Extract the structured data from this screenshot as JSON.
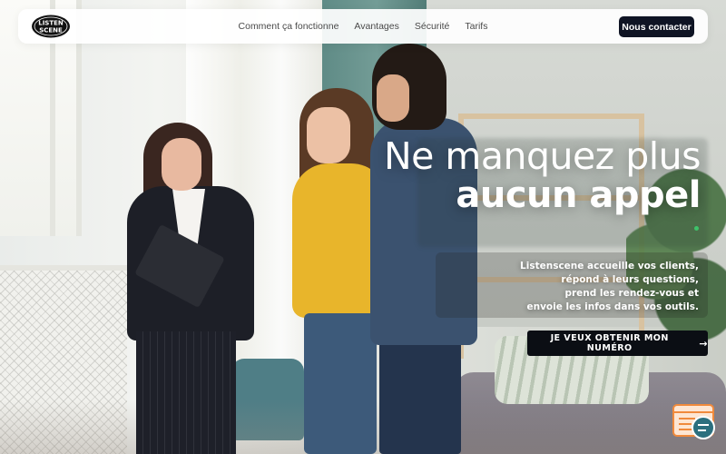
{
  "brand": {
    "logo_text_line1": "LISTEN",
    "logo_text_line2": "SCENE"
  },
  "nav": {
    "links": [
      {
        "label": "Comment ça fonctionne"
      },
      {
        "label": "Avantages"
      },
      {
        "label": "Sécurité"
      },
      {
        "label": "Tarifs"
      }
    ],
    "contact_label": "Nous contacter"
  },
  "hero": {
    "title_line1": "Ne manquez plus",
    "title_line2": "aucun appel",
    "description_lines": [
      "Listenscene accueille vos clients,",
      "répond à leurs questions,",
      "prend les rendez-vous et",
      "envoie les infos dans vos outils."
    ],
    "cta_label": "JE VEUX OBTENIR MON NUMÉRO",
    "cta_icon": "arrow-right-icon"
  },
  "widget": {
    "icon": "chat-widget-icon"
  },
  "colors": {
    "nav_bg": "#ffffff",
    "button_dark": "#0f1424",
    "cta_bg": "#0b0e14",
    "text_white": "#ffffff",
    "widget_orange": "#f08a3c",
    "widget_teal": "#2b6f7e"
  }
}
